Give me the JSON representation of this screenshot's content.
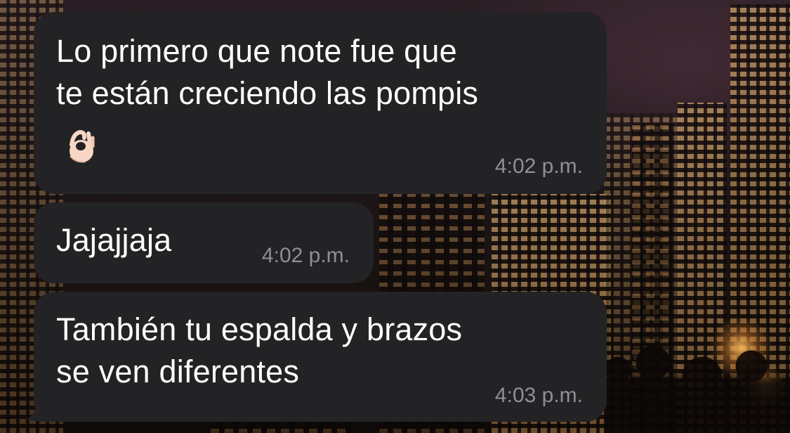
{
  "chat": {
    "messages": [
      {
        "text": "Lo primero que note fue que\nte están creciendo las pompis",
        "emoji": "👌",
        "emoji_name": "ok-hand-emoji",
        "time": "4:02 p.m."
      },
      {
        "text": "Jajajjaja",
        "time": "4:02 p.m."
      },
      {
        "text": "También tu espalda y brazos\nse ven diferentes",
        "time": "4:03 p.m."
      }
    ]
  },
  "colors": {
    "bubble": "#232325",
    "text": "#ffffff",
    "timestamp": "#8f8f95"
  },
  "background": {
    "description_icon": "night-city-wallpaper"
  }
}
